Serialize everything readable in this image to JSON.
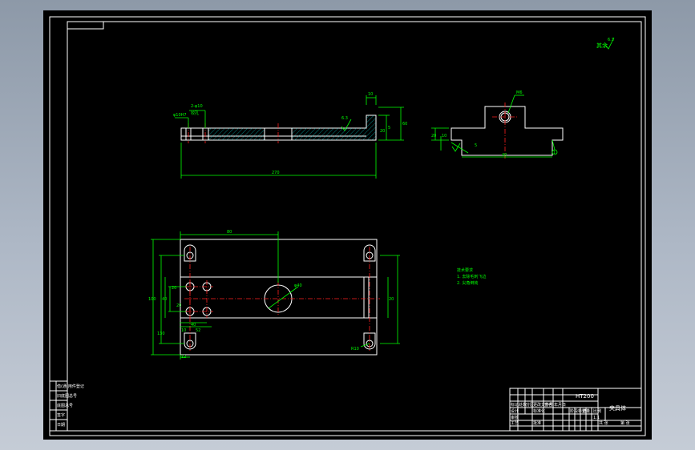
{
  "drawing": {
    "roughness_note": "其余",
    "roughness_value": "6.3",
    "tech_title": "技术要求",
    "tech_items": [
      "1. 去除毛刺飞边",
      "2. 尖角倒钝"
    ],
    "material": "HT200",
    "part_name": "夹具体"
  },
  "side_view": {
    "dims": [
      "φ10H7",
      "2-φ10",
      "铰孔",
      "10",
      "5",
      "60",
      "20",
      "270",
      "6.3"
    ]
  },
  "right_view": {
    "dims": [
      "M6",
      "20",
      "10",
      "5",
      "40",
      "1"
    ]
  },
  "top_view": {
    "dims": [
      "80",
      "φ40",
      "20",
      "40",
      "100",
      "130",
      "12",
      "20",
      "R10",
      "20",
      "40",
      "52",
      "10"
    ]
  },
  "title_block": {
    "labels": [
      "标记",
      "处数",
      "分区",
      "更改文件号",
      "签名",
      "年月日",
      "设计",
      "标准化",
      "审核",
      "工艺",
      "批准",
      "阶段标记",
      "重量",
      "比例",
      "共 张",
      "第 张"
    ],
    "scale": "1:1"
  },
  "left_stamp": {
    "labels": [
      "借(通)用件登记",
      "旧底图总号",
      "底图总号",
      "签字",
      "日期"
    ]
  },
  "colors": {
    "background": "#000000",
    "outline": "#ffffff",
    "dimension": "#00ff00",
    "centerline": "#ff2020",
    "hatch": "#00d8d8"
  }
}
